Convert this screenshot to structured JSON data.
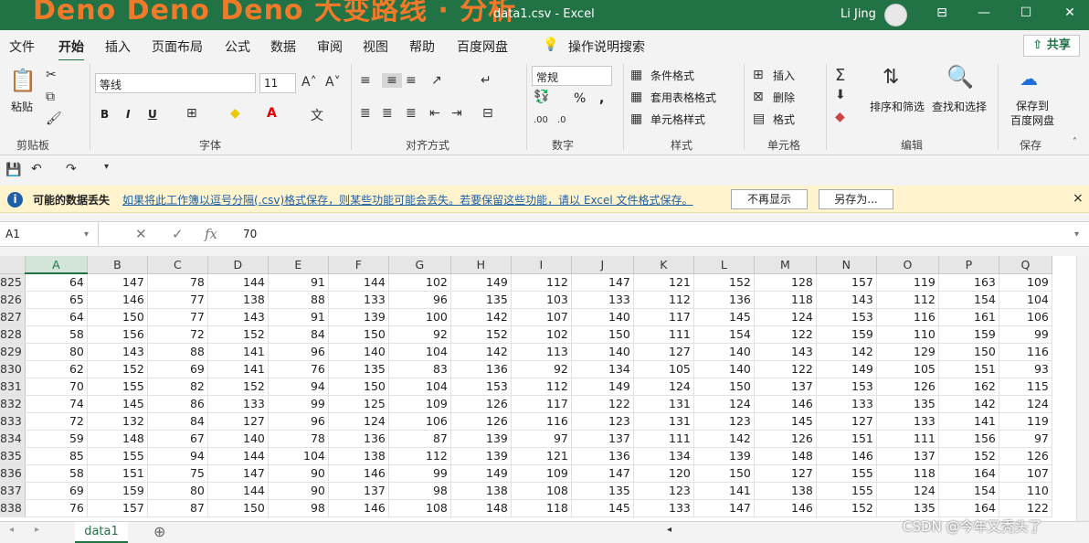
{
  "titlebar": {
    "overlay_text": "Deno Deno Deno 大变路线 · 分析",
    "file_title": "data1.csv - Excel",
    "user": "Li Jing",
    "minimize": "—",
    "restore": "☐",
    "close": "✕",
    "ribbon_display": "⊟"
  },
  "menu": {
    "tabs": [
      "文件",
      "开始",
      "插入",
      "页面布局",
      "公式",
      "数据",
      "审阅",
      "视图",
      "帮助",
      "百度网盘"
    ],
    "search": "操作说明搜索",
    "share": "共享"
  },
  "ribbon": {
    "clipboard": {
      "paste": "粘贴",
      "label": "剪贴板"
    },
    "font": {
      "name": "等线",
      "size": "11",
      "bold": "B",
      "italic": "I",
      "underline": "U",
      "label": "字体"
    },
    "alignment": {
      "label": "对齐方式"
    },
    "number": {
      "format": "常规",
      "percent": "%",
      "comma": ",",
      "label": "数字"
    },
    "styles": {
      "conditional": "条件格式",
      "table": "套用表格格式",
      "cell": "单元格样式",
      "label": "样式"
    },
    "cells": {
      "insert": "插入",
      "delete": "删除",
      "format": "格式",
      "label": "单元格"
    },
    "editing": {
      "sort": "排序和筛选",
      "find": "查找和选择",
      "label": "编辑"
    },
    "save": {
      "text": "保存到\n百度网盘",
      "line1": "保存到",
      "line2": "百度网盘",
      "label": "保存"
    }
  },
  "messagebar": {
    "title": "可能的数据丢失",
    "text": "如果将此工作簿以逗号分隔(.csv)格式保存，则某些功能可能会丢失。若要保留这些功能，请以 Excel 文件格式保存。",
    "dont_show": "不再显示",
    "save_as": "另存为...",
    "close": "×"
  },
  "formula": {
    "name_box": "A1",
    "value": "70"
  },
  "grid": {
    "columns": [
      "A",
      "B",
      "C",
      "D",
      "E",
      "F",
      "G",
      "H",
      "I",
      "J",
      "K",
      "L",
      "M",
      "N",
      "O",
      "P",
      "Q"
    ],
    "rows": [
      {
        "n": "825",
        "v": [
          64,
          147,
          78,
          144,
          91,
          144,
          102,
          149,
          112,
          147,
          121,
          152,
          128,
          157,
          119,
          163,
          109
        ]
      },
      {
        "n": "826",
        "v": [
          65,
          146,
          77,
          138,
          88,
          133,
          96,
          135,
          103,
          133,
          112,
          136,
          118,
          143,
          112,
          154,
          104
        ]
      },
      {
        "n": "827",
        "v": [
          64,
          150,
          77,
          143,
          91,
          139,
          100,
          142,
          107,
          140,
          117,
          145,
          124,
          153,
          116,
          161,
          106
        ]
      },
      {
        "n": "828",
        "v": [
          58,
          156,
          72,
          152,
          84,
          150,
          92,
          152,
          102,
          150,
          111,
          154,
          122,
          159,
          110,
          159,
          99
        ]
      },
      {
        "n": "829",
        "v": [
          80,
          143,
          88,
          141,
          96,
          140,
          104,
          142,
          113,
          140,
          127,
          140,
          143,
          142,
          129,
          150,
          116
        ]
      },
      {
        "n": "830",
        "v": [
          62,
          152,
          69,
          141,
          76,
          135,
          83,
          136,
          92,
          134,
          105,
          140,
          122,
          149,
          105,
          151,
          93
        ]
      },
      {
        "n": "831",
        "v": [
          70,
          155,
          82,
          152,
          94,
          150,
          104,
          153,
          112,
          149,
          124,
          150,
          137,
          153,
          126,
          162,
          115
        ]
      },
      {
        "n": "832",
        "v": [
          74,
          145,
          86,
          133,
          99,
          125,
          109,
          126,
          117,
          122,
          131,
          124,
          146,
          133,
          135,
          142,
          124
        ]
      },
      {
        "n": "833",
        "v": [
          72,
          132,
          84,
          127,
          96,
          124,
          106,
          126,
          116,
          123,
          131,
          123,
          145,
          127,
          133,
          141,
          119
        ]
      },
      {
        "n": "834",
        "v": [
          59,
          148,
          67,
          140,
          78,
          136,
          87,
          139,
          97,
          137,
          111,
          142,
          126,
          151,
          111,
          156,
          97
        ]
      },
      {
        "n": "835",
        "v": [
          85,
          155,
          94,
          144,
          104,
          138,
          112,
          139,
          121,
          136,
          134,
          139,
          148,
          146,
          137,
          152,
          126
        ]
      },
      {
        "n": "836",
        "v": [
          58,
          151,
          75,
          147,
          90,
          146,
          99,
          149,
          109,
          147,
          120,
          150,
          127,
          155,
          118,
          164,
          107
        ]
      },
      {
        "n": "837",
        "v": [
          69,
          159,
          80,
          144,
          90,
          137,
          98,
          138,
          108,
          135,
          123,
          141,
          138,
          155,
          124,
          154,
          110
        ]
      },
      {
        "n": "838",
        "v": [
          76,
          157,
          87,
          150,
          98,
          146,
          108,
          148,
          118,
          145,
          133,
          147,
          146,
          152,
          135,
          164,
          122
        ]
      }
    ]
  },
  "sheets": {
    "tab": "data1",
    "add": "⊕"
  },
  "watermark": "CSDN @今年又秃头了"
}
